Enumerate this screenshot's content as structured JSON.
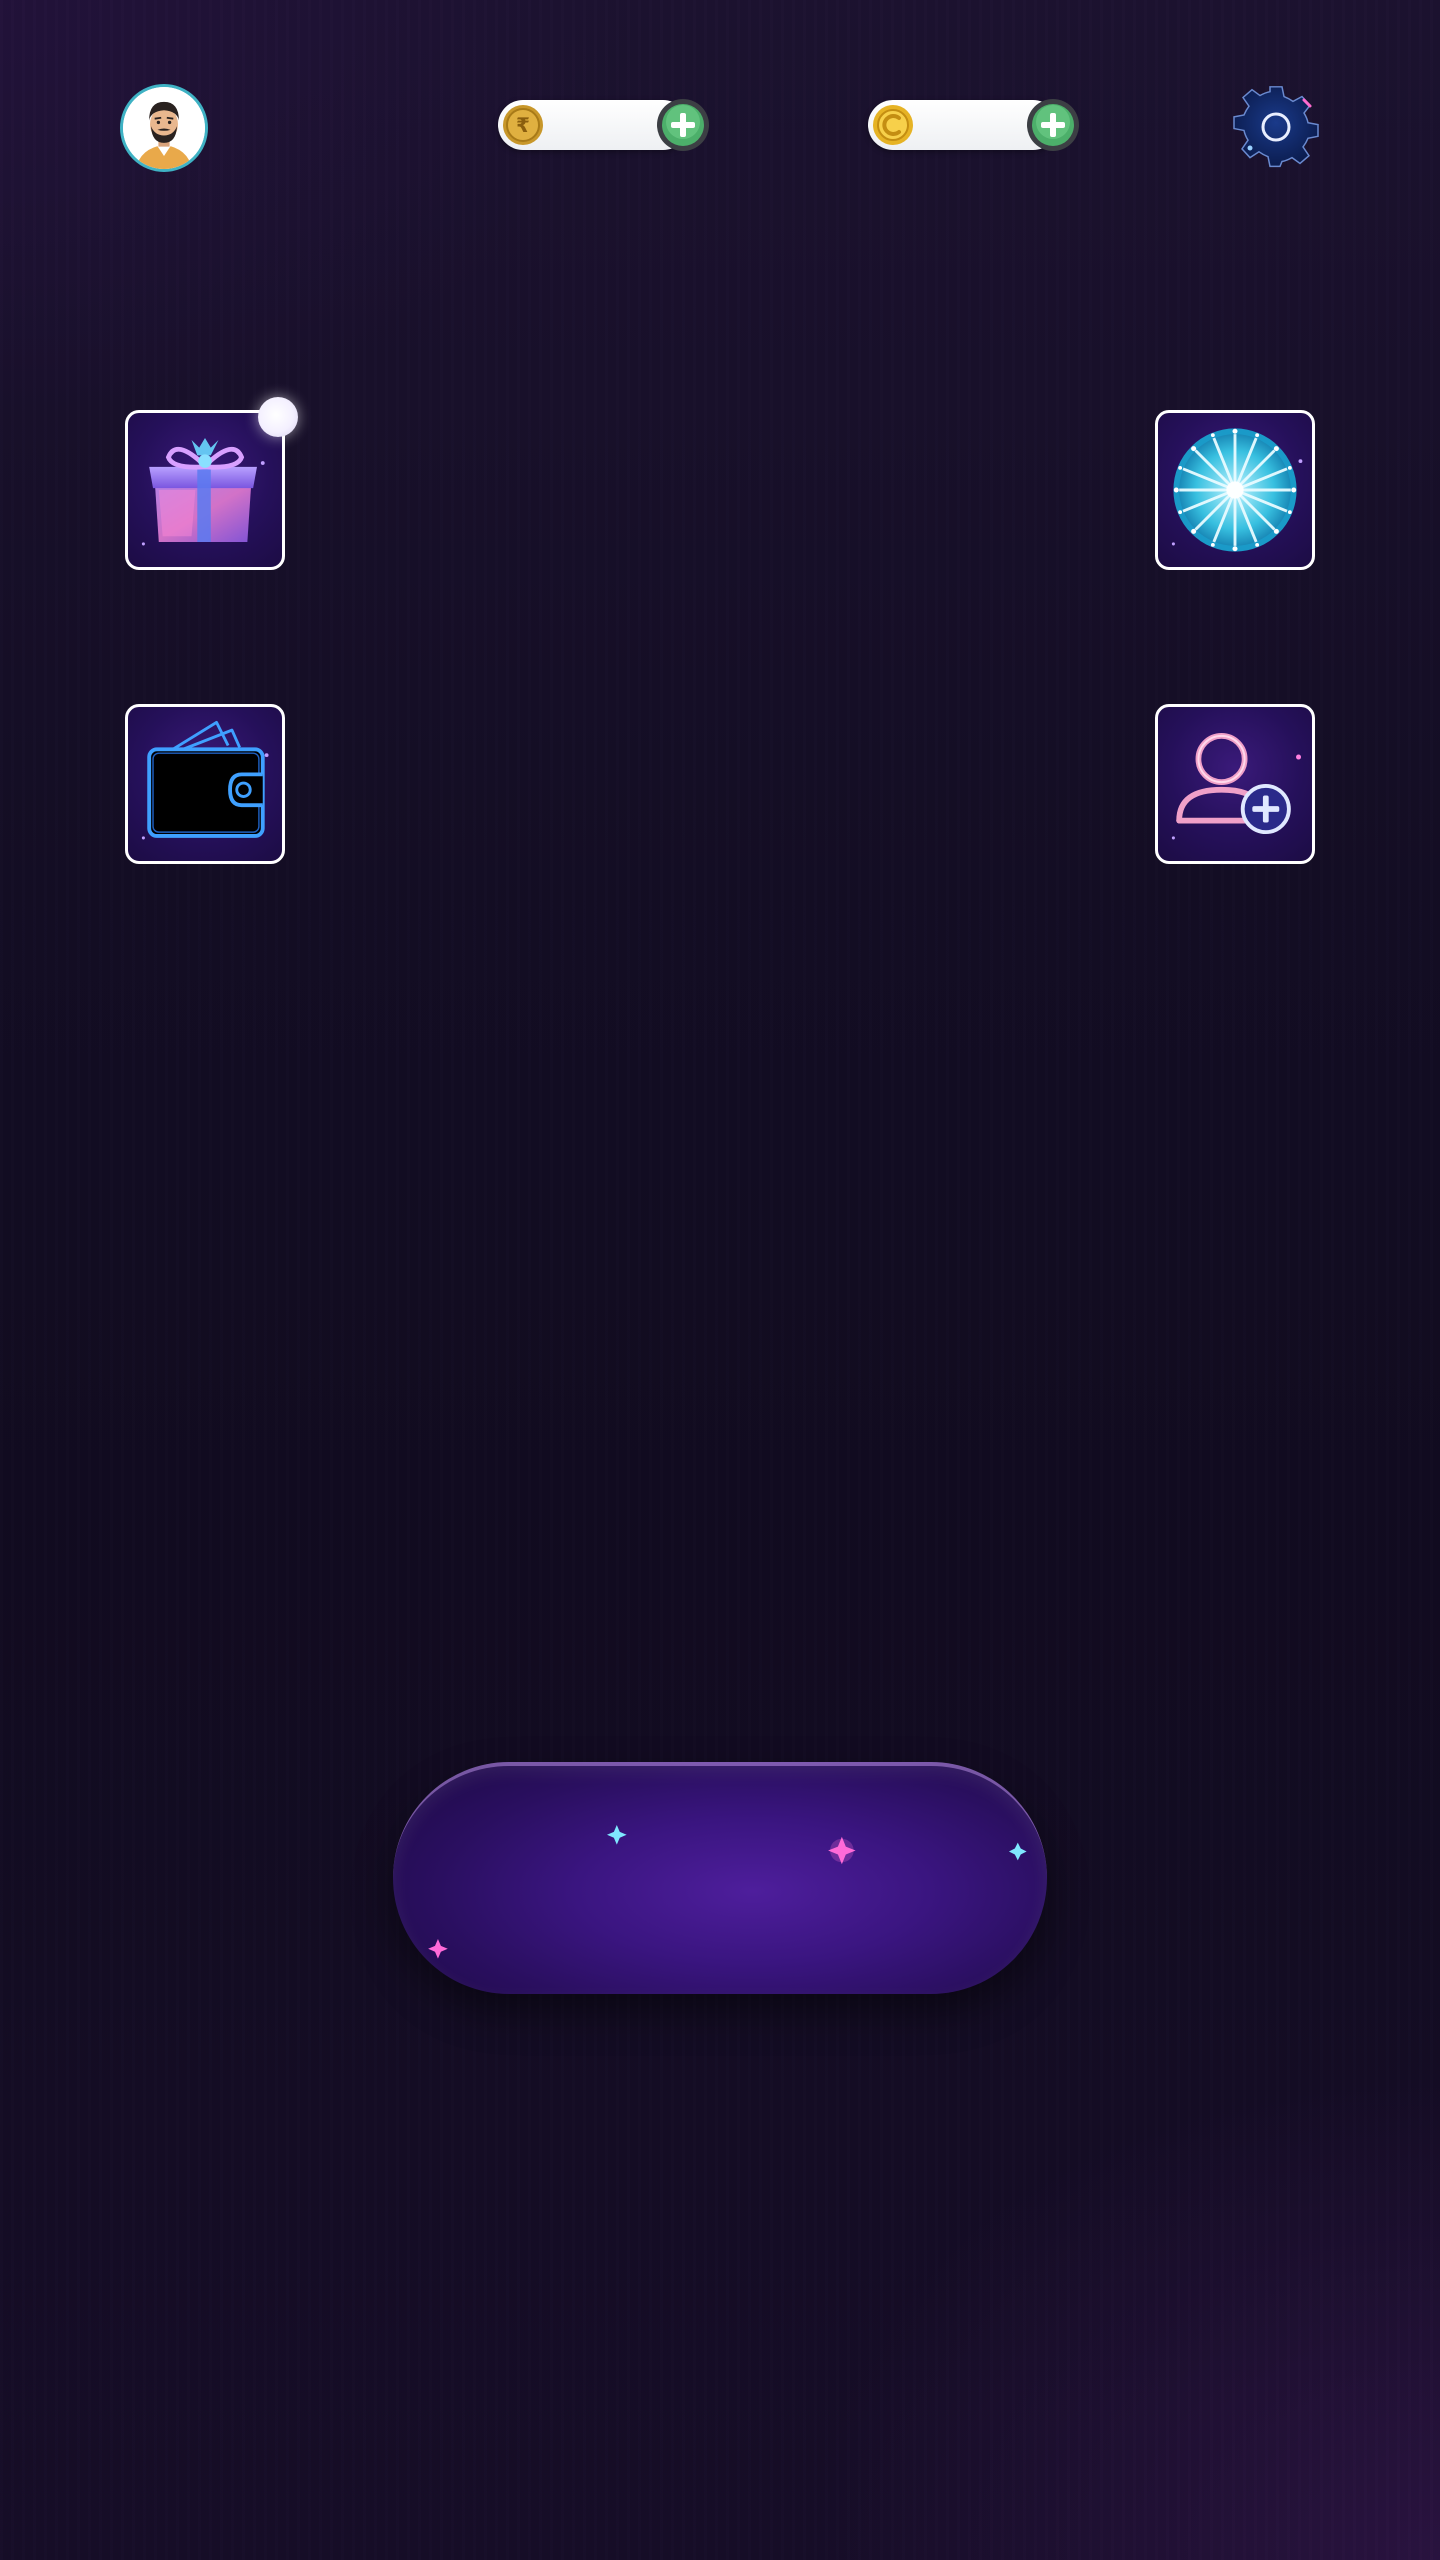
{
  "header": {
    "avatar_icon": "man-avatar-icon",
    "rupee_balance": {
      "icon": "rupee-coin-icon",
      "value": "",
      "add_icon": "plus-circle-icon"
    },
    "coin_balance": {
      "icon": "gold-coin-icon",
      "value": "",
      "add_icon": "plus-circle-icon"
    },
    "settings_icon": "gear-icon"
  },
  "tiles": [
    {
      "id": "gift",
      "icon": "gift-box-icon",
      "has_notification": true
    },
    {
      "id": "spin",
      "icon": "spin-wheel-icon",
      "has_notification": false
    },
    {
      "id": "wallet",
      "icon": "wallet-icon",
      "has_notification": false
    },
    {
      "id": "invite",
      "icon": "add-user-icon",
      "has_notification": false
    }
  ],
  "main_button": {
    "label": ""
  },
  "colors": {
    "background": "#130d24",
    "tile_border": "#ffffff",
    "tile_fill": "#25105a",
    "button_fill": "#3a1580",
    "add_green": "#4caf6a",
    "coin_gold": "#e6b325",
    "avatar_ring": "#3fb2c4"
  }
}
